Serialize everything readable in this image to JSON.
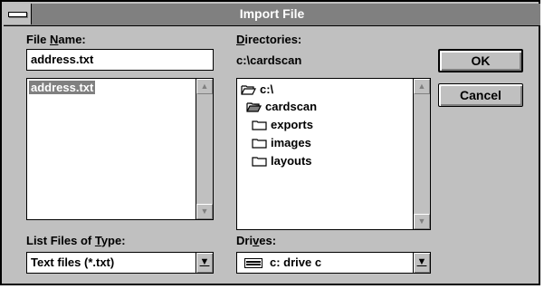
{
  "dialog": {
    "title": "Import File",
    "ok_label": "OK",
    "cancel_label": "Cancel"
  },
  "file_name": {
    "label_pre": "File ",
    "label_hot": "N",
    "label_post": "ame:",
    "value": "address.txt",
    "files": [
      "address.txt"
    ]
  },
  "directories": {
    "label_hot": "D",
    "label_post": "irectories:",
    "current_path": "c:\\cardscan",
    "items": [
      {
        "label": "c:\\",
        "icon": "open-folder-icon"
      },
      {
        "label": "cardscan",
        "icon": "open-folder-icon"
      },
      {
        "label": "exports",
        "icon": "folder-icon"
      },
      {
        "label": "images",
        "icon": "folder-icon"
      },
      {
        "label": "layouts",
        "icon": "folder-icon"
      }
    ]
  },
  "file_type": {
    "label_pre": "List Files of ",
    "label_hot": "T",
    "label_post": "ype:",
    "value": "Text files (*.txt)"
  },
  "drives": {
    "label_pre": "Dri",
    "label_hot": "v",
    "label_post": "es:",
    "value": "c: drive c",
    "icon": "drive-icon"
  },
  "colors": {
    "face": "#c0c0c0",
    "titlebar": "#808080",
    "selection": "#808080"
  }
}
